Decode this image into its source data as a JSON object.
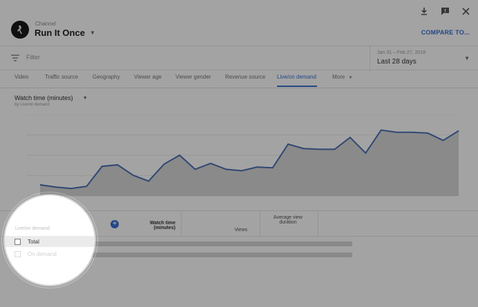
{
  "header": {
    "channel_label": "Channel",
    "channel_name": "Run It Once",
    "compare_label": "COMPARE TO..."
  },
  "filter": {
    "placeholder": "Filter",
    "date_range": "Jan 31 – Feb 27, 2019",
    "date_label": "Last 28 days"
  },
  "tabs": [
    {
      "label": "Video"
    },
    {
      "label": "Traffic source"
    },
    {
      "label": "Geography"
    },
    {
      "label": "Viewer age"
    },
    {
      "label": "Viewer gender"
    },
    {
      "label": "Revenue source"
    },
    {
      "label": "Live/on demand"
    },
    {
      "label": "More"
    }
  ],
  "active_tab": "Live/on demand",
  "metric": {
    "label": "Watch time (minutes)",
    "sublabel": "by Live/on demand"
  },
  "chart_data": {
    "type": "area",
    "series": [
      {
        "values": [
          15,
          12,
          10,
          13,
          40,
          42,
          28,
          20,
          43,
          55,
          36,
          44,
          36,
          34,
          39,
          38,
          70,
          64,
          63,
          63,
          79,
          58,
          89,
          86,
          86,
          85,
          75,
          88
        ]
      }
    ],
    "ylim": [
      0,
      110
    ],
    "grid": true,
    "color": "#4a6fb3"
  },
  "table": {
    "watch_time_header": "Watch time (minutes)",
    "views_header": "Views",
    "avg_duration_header": "Average view duration"
  },
  "spotlight": {
    "title": "Live/on demand",
    "options": [
      {
        "label": "Total",
        "checked": false
      },
      {
        "label": "On demand",
        "checked": false
      }
    ]
  }
}
